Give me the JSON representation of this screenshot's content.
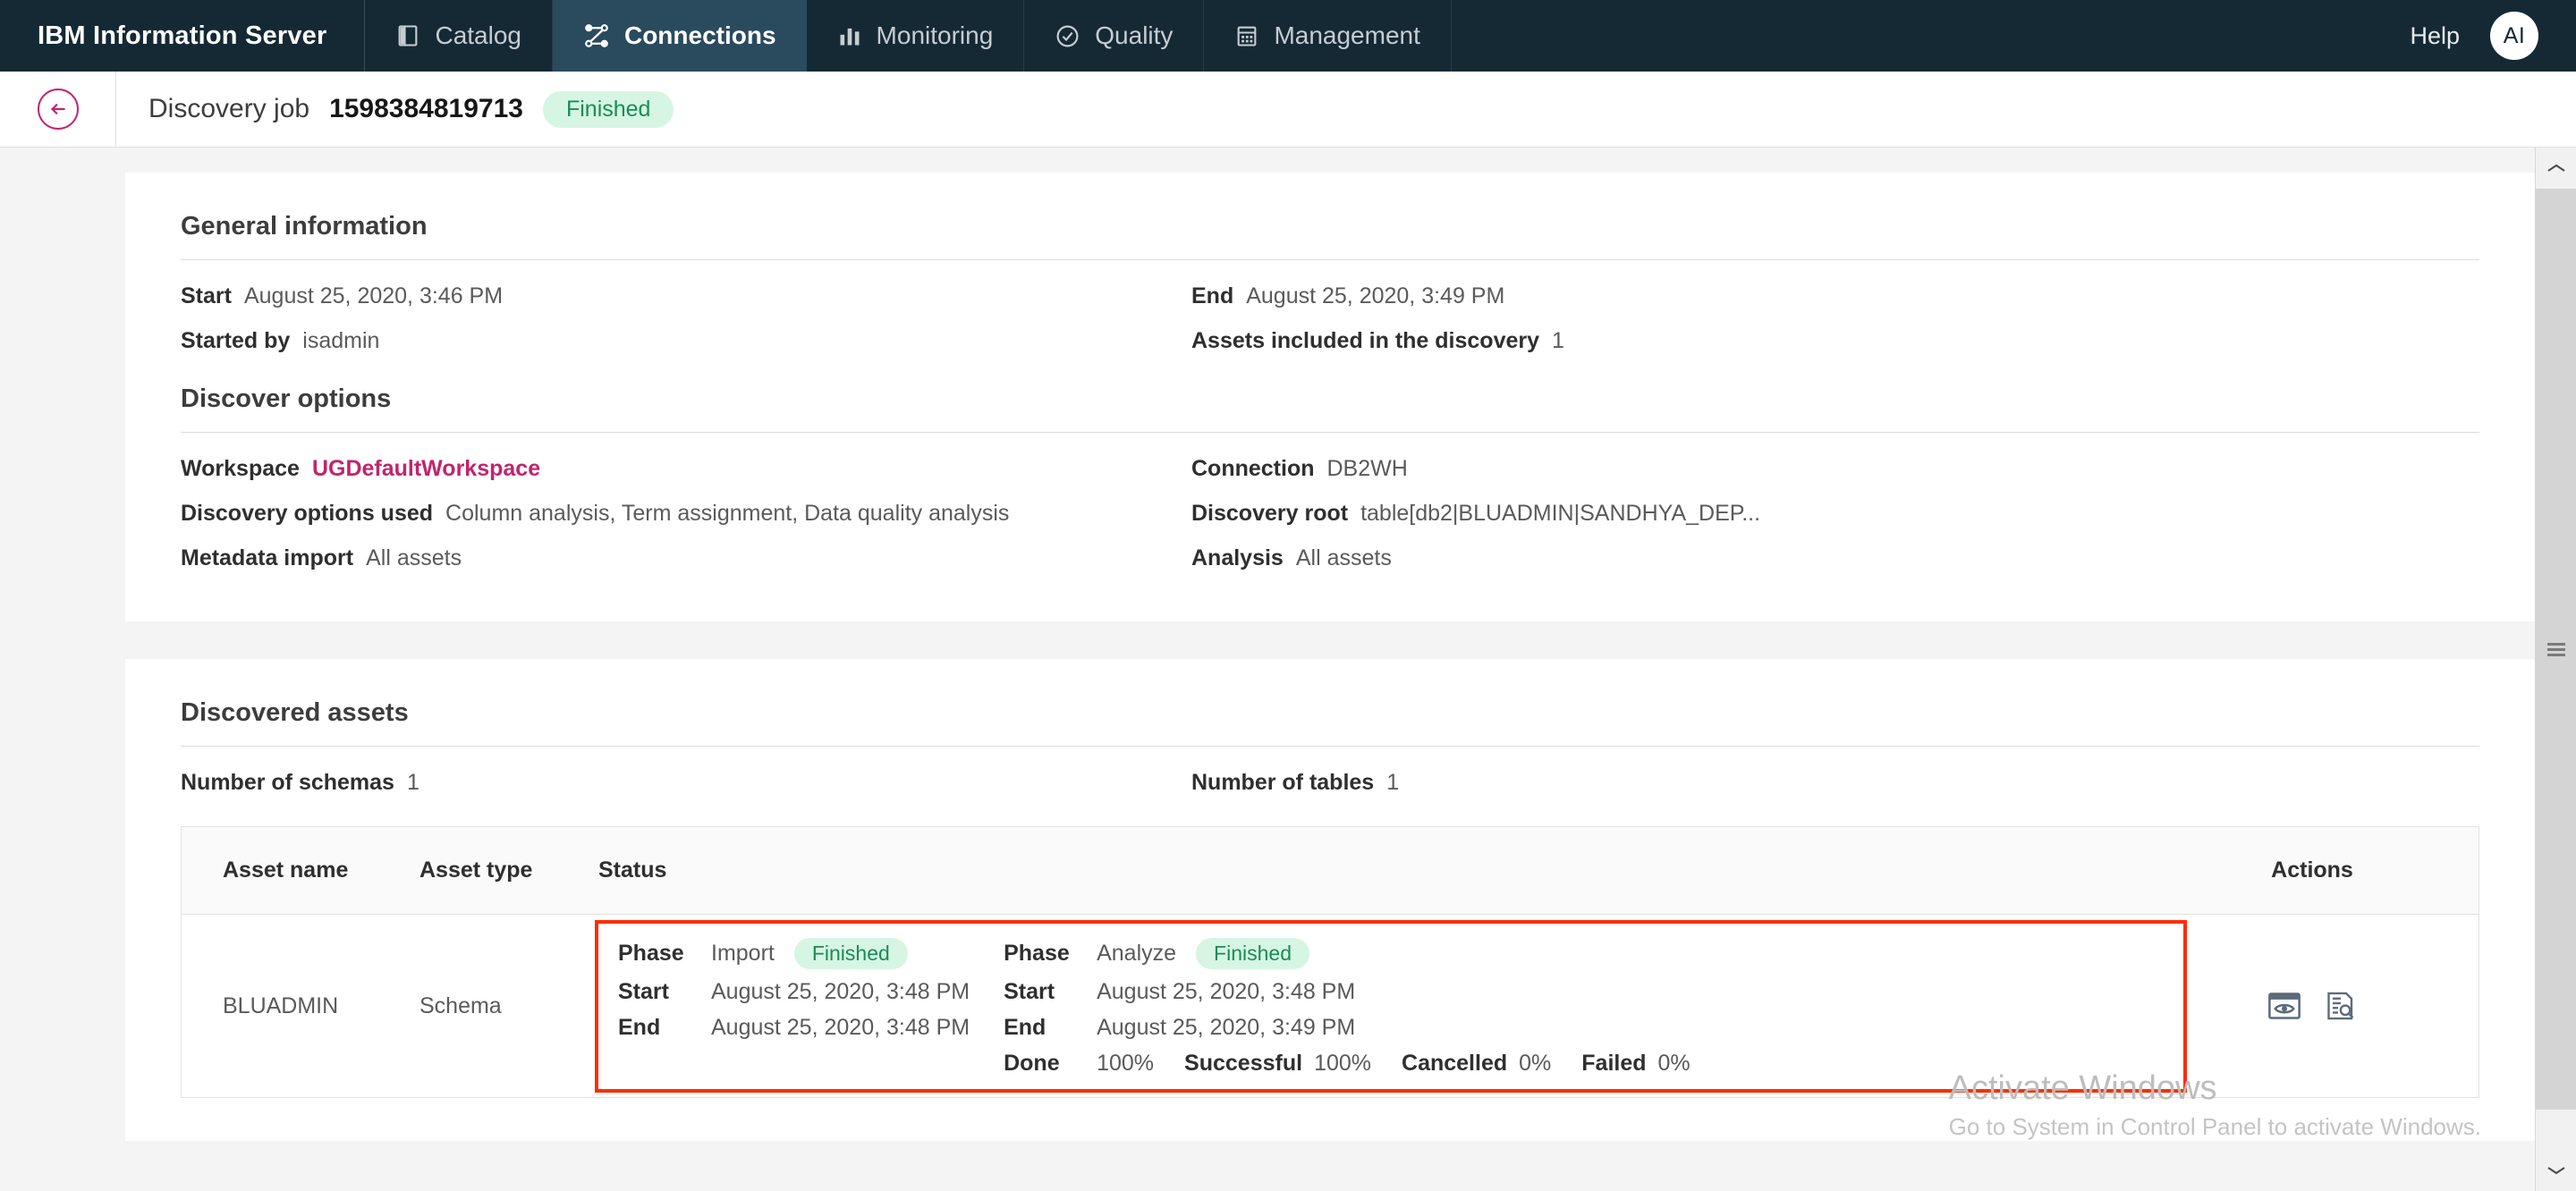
{
  "topnav": {
    "brand": "IBM Information Server",
    "tabs": [
      {
        "label": "Catalog",
        "icon": "book-icon",
        "active": false
      },
      {
        "label": "Connections",
        "icon": "connections-icon",
        "active": true
      },
      {
        "label": "Monitoring",
        "icon": "bar-chart-icon",
        "active": false
      },
      {
        "label": "Quality",
        "icon": "check-circle-icon",
        "active": false
      },
      {
        "label": "Management",
        "icon": "calendar-icon",
        "active": false
      }
    ],
    "help_label": "Help",
    "avatar_initials": "AI"
  },
  "pageheader": {
    "back_icon": "arrow-left-icon",
    "title_prefix": "Discovery job",
    "job_id": "1598384819713",
    "status": "Finished"
  },
  "general_information": {
    "section_title": "General information",
    "fields": [
      {
        "label": "Start",
        "value": "August 25, 2020, 3:46 PM"
      },
      {
        "label": "End",
        "value": "August 25, 2020, 3:49 PM"
      },
      {
        "label": "Started by",
        "value": "isadmin"
      },
      {
        "label": "Assets included in the discovery",
        "value": "1"
      }
    ]
  },
  "discover_options": {
    "section_title": "Discover options",
    "fields": [
      {
        "label": "Workspace",
        "value": "UGDefaultWorkspace",
        "link": true
      },
      {
        "label": "Connection",
        "value": "DB2WH"
      },
      {
        "label": "Discovery options used",
        "value": "Column analysis, Term assignment, Data quality analysis"
      },
      {
        "label": "Discovery root",
        "value": "table[db2|BLUADMIN|SANDHYA_DEP..."
      },
      {
        "label": "Metadata import",
        "value": "All assets"
      },
      {
        "label": "Analysis",
        "value": "All assets"
      }
    ]
  },
  "discovered_assets": {
    "section_title": "Discovered assets",
    "summary": [
      {
        "label": "Number of schemas",
        "value": "1"
      },
      {
        "label": "Number of tables",
        "value": "1"
      }
    ],
    "table": {
      "headers": [
        "Asset name",
        "Asset type",
        "Status",
        "Actions"
      ],
      "row": {
        "asset_name": "BLUADMIN",
        "asset_type": "Schema",
        "status": {
          "import": {
            "phase_label": "Phase",
            "phase_value": "Import",
            "phase_badge": "Finished",
            "start_label": "Start",
            "start_value": "August 25, 2020, 3:48 PM",
            "end_label": "End",
            "end_value": "August 25, 2020, 3:48 PM"
          },
          "analyze": {
            "phase_label": "Phase",
            "phase_value": "Analyze",
            "phase_badge": "Finished",
            "start_label": "Start",
            "start_value": "August 25, 2020, 3:48 PM",
            "end_label": "End",
            "end_value": "August 25, 2020, 3:49 PM",
            "done_label": "Done",
            "done_value": "100%",
            "successful_label": "Successful",
            "successful_value": "100%",
            "cancelled_label": "Cancelled",
            "cancelled_value": "0%",
            "failed_label": "Failed",
            "failed_value": "0%"
          }
        },
        "actions": [
          {
            "icon": "preview-eye-icon"
          },
          {
            "icon": "document-search-icon"
          }
        ]
      }
    }
  },
  "watermark": {
    "line1": "Activate Windows",
    "line2": "Go to System in Control Panel to activate Windows."
  },
  "colors": {
    "nav_bg": "#152935",
    "nav_active": "#2a4a5e",
    "accent_magenta": "#c2246c",
    "status_green_text": "#198c54",
    "status_green_bg": "#d6f5e3",
    "highlight_red": "#ff2d00"
  }
}
